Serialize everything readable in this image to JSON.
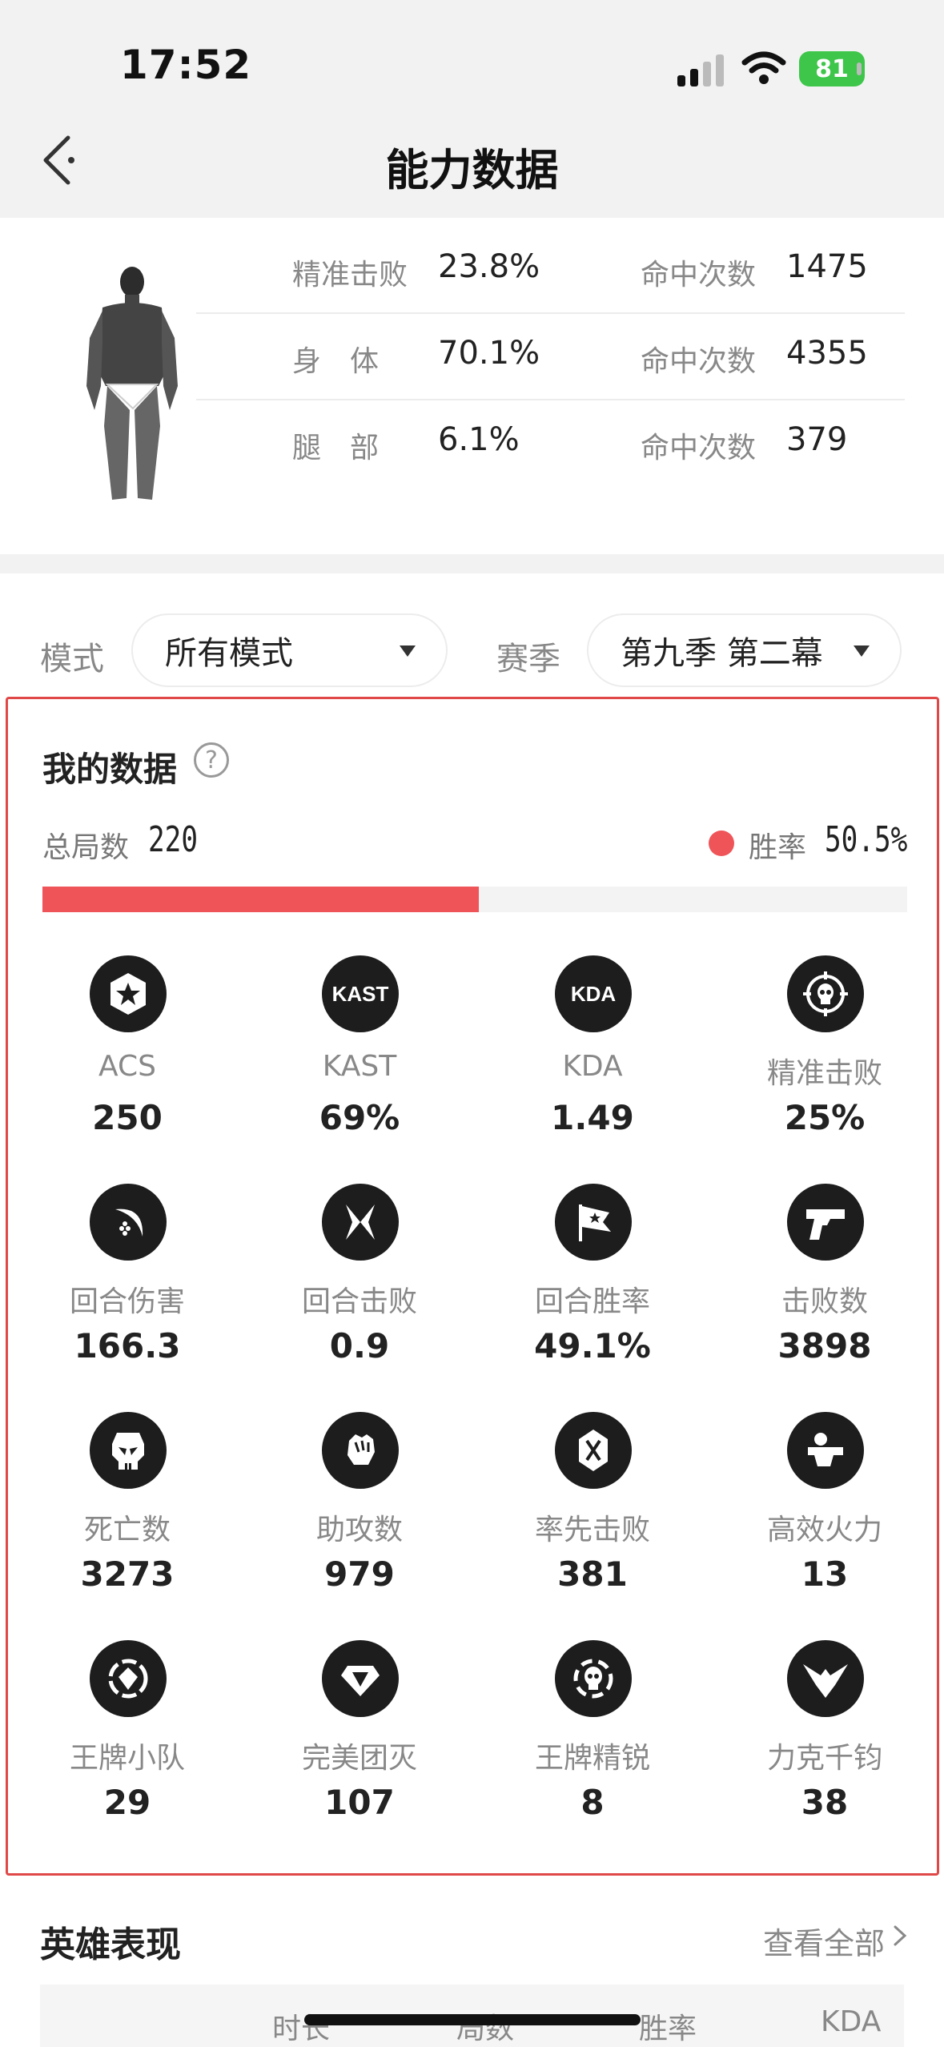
{
  "status_bar": {
    "time": "17:52",
    "battery": "81"
  },
  "header": {
    "title": "能力数据"
  },
  "hit_stats": [
    {
      "label": "精准击败",
      "percent": "23.8%",
      "count_label": "命中次数",
      "count": "1475"
    },
    {
      "label": "身　体",
      "percent": "70.1%",
      "count_label": "命中次数",
      "count": "4355"
    },
    {
      "label": "腿　部",
      "percent": "6.1%",
      "count_label": "命中次数",
      "count": "379"
    }
  ],
  "filters": {
    "mode_label": "模式",
    "mode_value": "所有模式",
    "season_label": "赛季",
    "season_value": "第九季 第二幕"
  },
  "my_data": {
    "title": "我的数据",
    "help_glyph": "?",
    "total_label": "总局数",
    "total_value": "220",
    "win_label": "胜率",
    "win_value": "50.5%",
    "win_rate_fraction": 0.505,
    "accent_color": "#ef5458",
    "stats": [
      {
        "name": "ACS",
        "value": "250",
        "icon": "star-badge-icon"
      },
      {
        "name": "KAST",
        "value": "69%",
        "icon": "kast-icon",
        "icon_text": "KAST"
      },
      {
        "name": "KDA",
        "value": "1.49",
        "icon": "kda-icon",
        "icon_text": "KDA"
      },
      {
        "name": "精准击败",
        "value": "25%",
        "icon": "crosshair-skull-icon"
      },
      {
        "name": "回合伤害",
        "value": "166.3",
        "icon": "slash-icon"
      },
      {
        "name": "回合击败",
        "value": "0.9",
        "icon": "crossed-blades-icon"
      },
      {
        "name": "回合胜率",
        "value": "49.1%",
        "icon": "flag-icon"
      },
      {
        "name": "击败数",
        "value": "3898",
        "icon": "pistol-icon"
      },
      {
        "name": "死亡数",
        "value": "3273",
        "icon": "skull-icon"
      },
      {
        "name": "助攻数",
        "value": "979",
        "icon": "fist-icon"
      },
      {
        "name": "率先击败",
        "value": "381",
        "icon": "first-blood-icon"
      },
      {
        "name": "高效火力",
        "value": "13",
        "icon": "gun-hand-icon"
      },
      {
        "name": "王牌小队",
        "value": "29",
        "icon": "ace-squad-icon"
      },
      {
        "name": "完美团灭",
        "value": "107",
        "icon": "diamond-icon"
      },
      {
        "name": "王牌精锐",
        "value": "8",
        "icon": "elite-skull-icon"
      },
      {
        "name": "力克千钧",
        "value": "38",
        "icon": "eagle-icon"
      }
    ]
  },
  "hero_section": {
    "title": "英雄表现",
    "see_all": "查看全部",
    "columns": [
      "时长",
      "局数",
      "胜率",
      "KDA"
    ]
  }
}
